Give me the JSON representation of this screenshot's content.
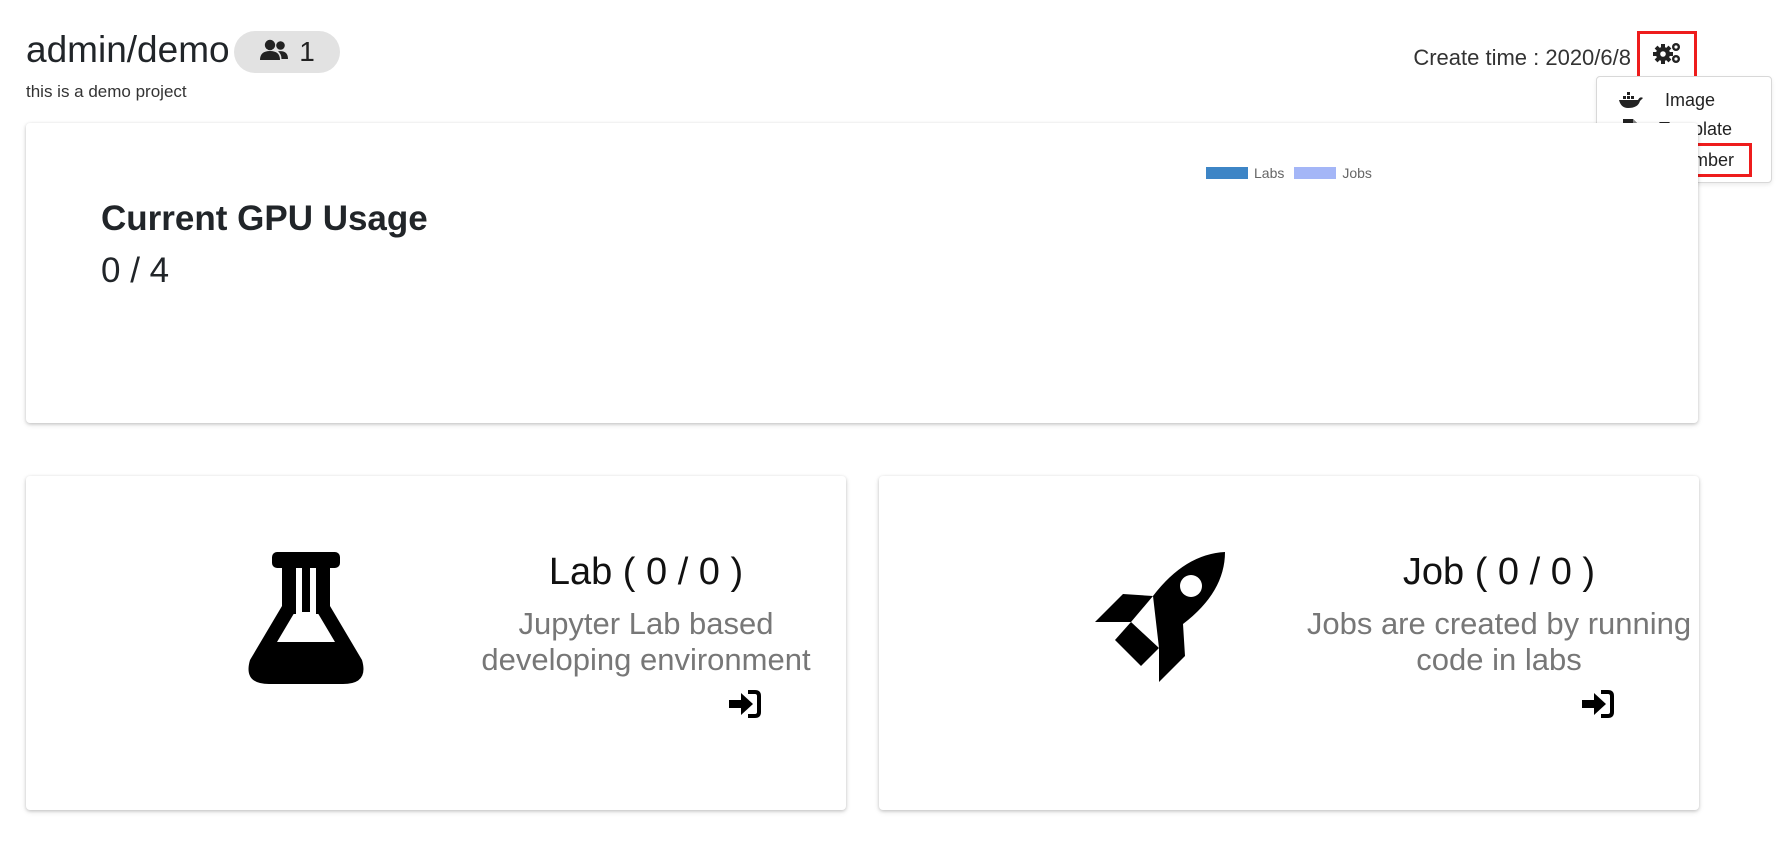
{
  "header": {
    "project_title": "admin/demo",
    "member_count": "1",
    "description": "this is a demo project",
    "create_time": "Create time : 2020/6/8"
  },
  "settings_menu": {
    "items": [
      {
        "label": "Image",
        "icon": "docker-icon"
      },
      {
        "label": "Template",
        "icon": "file-code-icon"
      },
      {
        "label": "Member",
        "icon": "users-icon"
      }
    ],
    "highlight_color": "#ee1c1c"
  },
  "gpu": {
    "title": "Current GPU Usage",
    "value": "0 / 4"
  },
  "chart_data": {
    "type": "bar",
    "series": [
      {
        "name": "Labs",
        "values": [],
        "color": "#3d85c6"
      },
      {
        "name": "Jobs",
        "values": [],
        "color": "#a4b6f7"
      }
    ],
    "legend_position": "top"
  },
  "lab": {
    "title": "Lab ( 0 / 0 )",
    "description": "Jupyter Lab based developing environment"
  },
  "job": {
    "title": "Job ( 0 / 0 )",
    "description": "Jobs are created by running code in labs"
  }
}
